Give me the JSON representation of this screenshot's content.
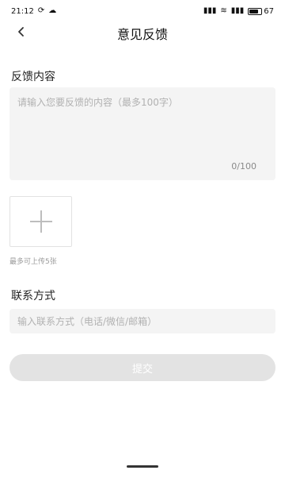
{
  "status_bar": {
    "time": "21:12",
    "left_icons": [
      "sync-icon",
      "cloud-icon"
    ],
    "right_icons": [
      "signal-icon",
      "wifi-icon",
      "signal-icon"
    ],
    "battery_level": "67"
  },
  "header": {
    "title": "意见反馈",
    "back_icon": "chevron-left-icon"
  },
  "feedback": {
    "section_title": "反馈内容",
    "placeholder": "请输入您要反馈的内容（最多100字）",
    "value": "",
    "char_count": "0/100"
  },
  "upload": {
    "icon": "plus-icon",
    "note": "最多可上传5张"
  },
  "contact": {
    "section_title": "联系方式",
    "placeholder": "输入联系方式（电话/微信/邮箱）",
    "value": ""
  },
  "submit": {
    "label": "提交",
    "background_color": "#e3e3e3",
    "text_color": "#ffffff"
  },
  "colors": {
    "input_background": "#f4f4f4",
    "placeholder": "#b1b1b1",
    "border": "#e2e2e2"
  }
}
